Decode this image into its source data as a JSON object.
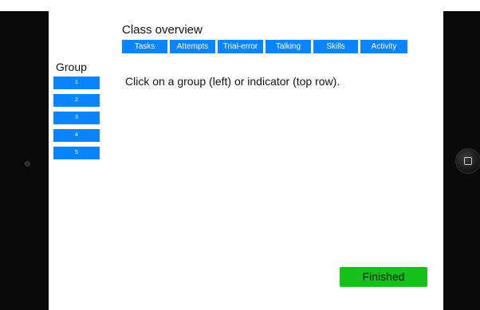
{
  "header": {
    "title": "Class overview"
  },
  "indicator_tabs": [
    {
      "label": "Tasks"
    },
    {
      "label": "Attempts"
    },
    {
      "label": "Trial-error"
    },
    {
      "label": "Talking"
    },
    {
      "label": "Skills"
    },
    {
      "label": "Activity"
    }
  ],
  "sidebar": {
    "title": "Group",
    "groups": [
      {
        "label": "1"
      },
      {
        "label": "2"
      },
      {
        "label": "3"
      },
      {
        "label": "4"
      },
      {
        "label": "5"
      }
    ]
  },
  "main": {
    "instruction": "Click on a group (left) or indicator (top row)."
  },
  "footer": {
    "finished_label": "Finished"
  },
  "colors": {
    "accent_blue": "#0a84ff",
    "finished_green": "#15c21b",
    "bezel": "#0a0a0a"
  },
  "icons": {
    "camera": "camera-icon",
    "home_button": "home-button-icon"
  }
}
